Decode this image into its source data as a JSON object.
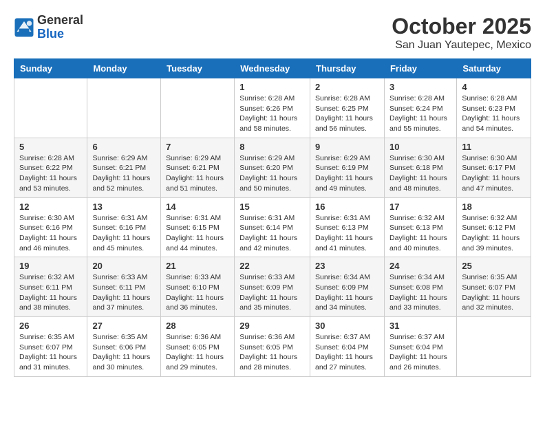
{
  "header": {
    "logo_general": "General",
    "logo_blue": "Blue",
    "month": "October 2025",
    "location": "San Juan Yautepec, Mexico"
  },
  "weekdays": [
    "Sunday",
    "Monday",
    "Tuesday",
    "Wednesday",
    "Thursday",
    "Friday",
    "Saturday"
  ],
  "weeks": [
    [
      {
        "day": "",
        "sunrise": "",
        "sunset": "",
        "daylight": ""
      },
      {
        "day": "",
        "sunrise": "",
        "sunset": "",
        "daylight": ""
      },
      {
        "day": "",
        "sunrise": "",
        "sunset": "",
        "daylight": ""
      },
      {
        "day": "1",
        "sunrise": "Sunrise: 6:28 AM",
        "sunset": "Sunset: 6:26 PM",
        "daylight": "Daylight: 11 hours and 58 minutes."
      },
      {
        "day": "2",
        "sunrise": "Sunrise: 6:28 AM",
        "sunset": "Sunset: 6:25 PM",
        "daylight": "Daylight: 11 hours and 56 minutes."
      },
      {
        "day": "3",
        "sunrise": "Sunrise: 6:28 AM",
        "sunset": "Sunset: 6:24 PM",
        "daylight": "Daylight: 11 hours and 55 minutes."
      },
      {
        "day": "4",
        "sunrise": "Sunrise: 6:28 AM",
        "sunset": "Sunset: 6:23 PM",
        "daylight": "Daylight: 11 hours and 54 minutes."
      }
    ],
    [
      {
        "day": "5",
        "sunrise": "Sunrise: 6:28 AM",
        "sunset": "Sunset: 6:22 PM",
        "daylight": "Daylight: 11 hours and 53 minutes."
      },
      {
        "day": "6",
        "sunrise": "Sunrise: 6:29 AM",
        "sunset": "Sunset: 6:21 PM",
        "daylight": "Daylight: 11 hours and 52 minutes."
      },
      {
        "day": "7",
        "sunrise": "Sunrise: 6:29 AM",
        "sunset": "Sunset: 6:21 PM",
        "daylight": "Daylight: 11 hours and 51 minutes."
      },
      {
        "day": "8",
        "sunrise": "Sunrise: 6:29 AM",
        "sunset": "Sunset: 6:20 PM",
        "daylight": "Daylight: 11 hours and 50 minutes."
      },
      {
        "day": "9",
        "sunrise": "Sunrise: 6:29 AM",
        "sunset": "Sunset: 6:19 PM",
        "daylight": "Daylight: 11 hours and 49 minutes."
      },
      {
        "day": "10",
        "sunrise": "Sunrise: 6:30 AM",
        "sunset": "Sunset: 6:18 PM",
        "daylight": "Daylight: 11 hours and 48 minutes."
      },
      {
        "day": "11",
        "sunrise": "Sunrise: 6:30 AM",
        "sunset": "Sunset: 6:17 PM",
        "daylight": "Daylight: 11 hours and 47 minutes."
      }
    ],
    [
      {
        "day": "12",
        "sunrise": "Sunrise: 6:30 AM",
        "sunset": "Sunset: 6:16 PM",
        "daylight": "Daylight: 11 hours and 46 minutes."
      },
      {
        "day": "13",
        "sunrise": "Sunrise: 6:31 AM",
        "sunset": "Sunset: 6:16 PM",
        "daylight": "Daylight: 11 hours and 45 minutes."
      },
      {
        "day": "14",
        "sunrise": "Sunrise: 6:31 AM",
        "sunset": "Sunset: 6:15 PM",
        "daylight": "Daylight: 11 hours and 44 minutes."
      },
      {
        "day": "15",
        "sunrise": "Sunrise: 6:31 AM",
        "sunset": "Sunset: 6:14 PM",
        "daylight": "Daylight: 11 hours and 42 minutes."
      },
      {
        "day": "16",
        "sunrise": "Sunrise: 6:31 AM",
        "sunset": "Sunset: 6:13 PM",
        "daylight": "Daylight: 11 hours and 41 minutes."
      },
      {
        "day": "17",
        "sunrise": "Sunrise: 6:32 AM",
        "sunset": "Sunset: 6:13 PM",
        "daylight": "Daylight: 11 hours and 40 minutes."
      },
      {
        "day": "18",
        "sunrise": "Sunrise: 6:32 AM",
        "sunset": "Sunset: 6:12 PM",
        "daylight": "Daylight: 11 hours and 39 minutes."
      }
    ],
    [
      {
        "day": "19",
        "sunrise": "Sunrise: 6:32 AM",
        "sunset": "Sunset: 6:11 PM",
        "daylight": "Daylight: 11 hours and 38 minutes."
      },
      {
        "day": "20",
        "sunrise": "Sunrise: 6:33 AM",
        "sunset": "Sunset: 6:11 PM",
        "daylight": "Daylight: 11 hours and 37 minutes."
      },
      {
        "day": "21",
        "sunrise": "Sunrise: 6:33 AM",
        "sunset": "Sunset: 6:10 PM",
        "daylight": "Daylight: 11 hours and 36 minutes."
      },
      {
        "day": "22",
        "sunrise": "Sunrise: 6:33 AM",
        "sunset": "Sunset: 6:09 PM",
        "daylight": "Daylight: 11 hours and 35 minutes."
      },
      {
        "day": "23",
        "sunrise": "Sunrise: 6:34 AM",
        "sunset": "Sunset: 6:09 PM",
        "daylight": "Daylight: 11 hours and 34 minutes."
      },
      {
        "day": "24",
        "sunrise": "Sunrise: 6:34 AM",
        "sunset": "Sunset: 6:08 PM",
        "daylight": "Daylight: 11 hours and 33 minutes."
      },
      {
        "day": "25",
        "sunrise": "Sunrise: 6:35 AM",
        "sunset": "Sunset: 6:07 PM",
        "daylight": "Daylight: 11 hours and 32 minutes."
      }
    ],
    [
      {
        "day": "26",
        "sunrise": "Sunrise: 6:35 AM",
        "sunset": "Sunset: 6:07 PM",
        "daylight": "Daylight: 11 hours and 31 minutes."
      },
      {
        "day": "27",
        "sunrise": "Sunrise: 6:35 AM",
        "sunset": "Sunset: 6:06 PM",
        "daylight": "Daylight: 11 hours and 30 minutes."
      },
      {
        "day": "28",
        "sunrise": "Sunrise: 6:36 AM",
        "sunset": "Sunset: 6:05 PM",
        "daylight": "Daylight: 11 hours and 29 minutes."
      },
      {
        "day": "29",
        "sunrise": "Sunrise: 6:36 AM",
        "sunset": "Sunset: 6:05 PM",
        "daylight": "Daylight: 11 hours and 28 minutes."
      },
      {
        "day": "30",
        "sunrise": "Sunrise: 6:37 AM",
        "sunset": "Sunset: 6:04 PM",
        "daylight": "Daylight: 11 hours and 27 minutes."
      },
      {
        "day": "31",
        "sunrise": "Sunrise: 6:37 AM",
        "sunset": "Sunset: 6:04 PM",
        "daylight": "Daylight: 11 hours and 26 minutes."
      },
      {
        "day": "",
        "sunrise": "",
        "sunset": "",
        "daylight": ""
      }
    ]
  ]
}
